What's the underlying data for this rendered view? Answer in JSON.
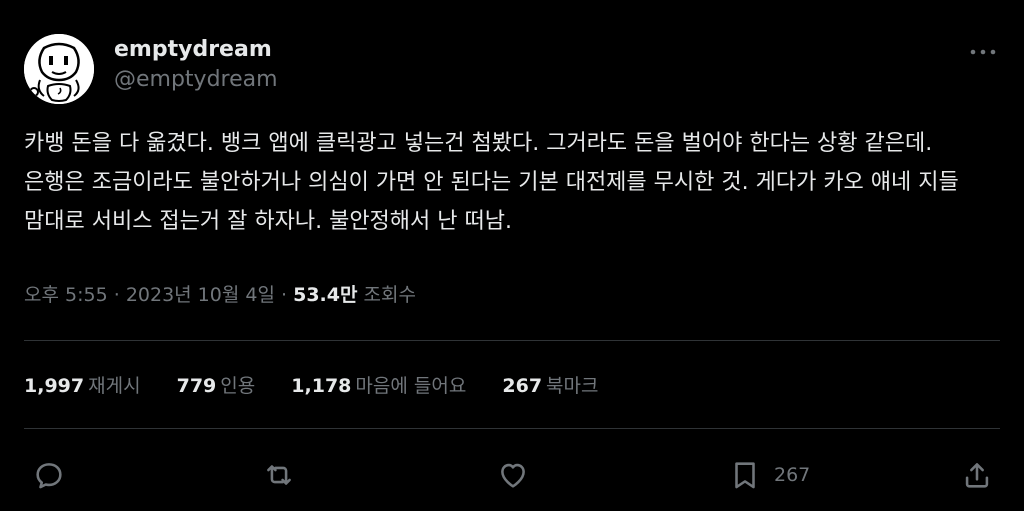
{
  "author": {
    "display_name": "emptydream",
    "handle": "@emptydream"
  },
  "tweet": {
    "text": "카뱅 돈을 다 옮겼다. 뱅크 앱에 클릭광고 넣는건 첨봤다. 그거라도 돈을 벌어야 한다는 상황 같은데. 은행은 조금이라도 불안하거나 의심이 가면 안 된다는 기본 대전제를 무시한 것. 게다가 카오 얘네 지들 맘대로 서비스 접는거 잘 하자나. 불안정해서 난 떠남.",
    "time": "오후 5:55",
    "date": "2023년 10월 4일",
    "views_count": "53.4만",
    "views_label": "조회수"
  },
  "stats": {
    "retweets": {
      "count": "1,997",
      "label": "재게시"
    },
    "quotes": {
      "count": "779",
      "label": "인용"
    },
    "likes": {
      "count": "1,178",
      "label": "마음에 들어요"
    },
    "bookmarks": {
      "count": "267",
      "label": "북마크"
    }
  },
  "actions": {
    "reply_icon": "reply-icon",
    "retweet_icon": "retweet-icon",
    "like_icon": "heart-icon",
    "bookmark_icon": "bookmark-icon",
    "bookmark_count": "267",
    "share_icon": "share-icon"
  },
  "colors": {
    "background": "#000000",
    "text_primary": "#e7e9ea",
    "text_secondary": "#71767b",
    "divider": "#2f3336"
  }
}
